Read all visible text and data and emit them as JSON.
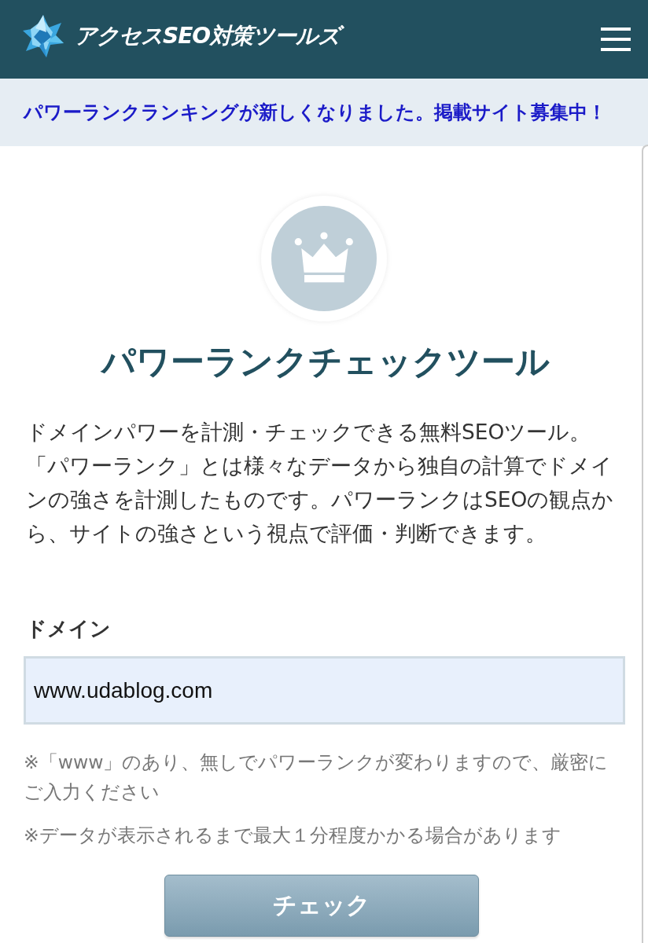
{
  "header": {
    "logo": "アクセスSEO対策ツールズ"
  },
  "notice": {
    "text": "パワーランクランキングが新しくなりました。掲載サイト募集中！"
  },
  "tool": {
    "title": "パワーランクチェックツール",
    "description": "ドメインパワーを計測・チェックできる無料SEOツール。「パワーランク」とは様々なデータから独自の計算でドメインの強さを計測したものです。パワーランクはSEOの観点から、サイトの強さという視点で評価・判断できます。",
    "field": {
      "label": "ドメイン",
      "value": "www.udablog.com"
    },
    "notes": [
      "※「www」のあり、無しでパワーランクが変わりますので、厳密にご入力ください",
      "※データが表示されるまで最大１分程度かかる場合があります"
    ],
    "button": "チェック"
  }
}
